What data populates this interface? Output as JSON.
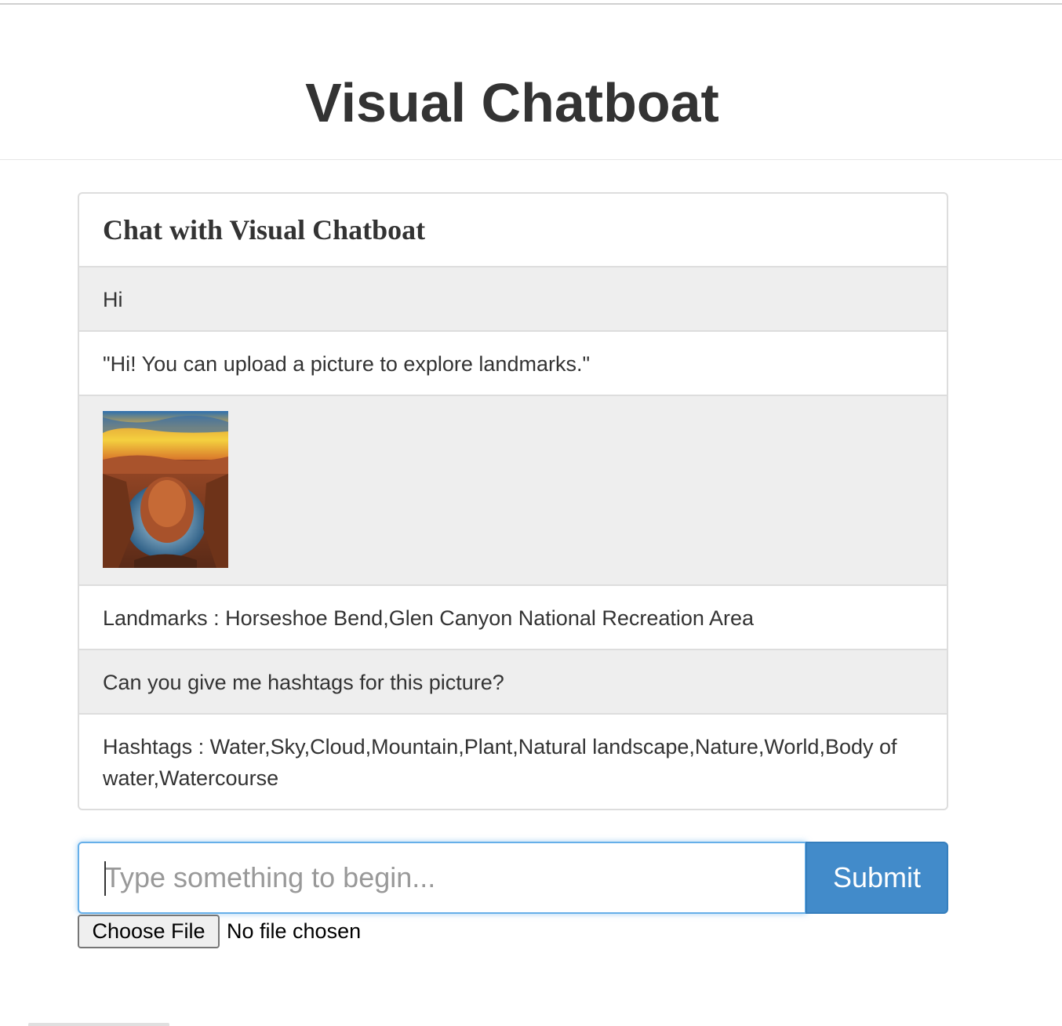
{
  "header": {
    "title": "Visual Chatboat"
  },
  "chat": {
    "panel_title": "Chat with Visual Chatboat",
    "messages": [
      {
        "from": "user",
        "text": "Hi"
      },
      {
        "from": "bot",
        "text": "\"Hi! You can upload a picture to explore landmarks.\""
      },
      {
        "from": "user",
        "type": "image"
      },
      {
        "from": "bot",
        "text": "Landmarks : Horseshoe Bend,Glen Canyon National Recreation Area"
      },
      {
        "from": "user",
        "text": "Can you give me hashtags for this picture?"
      },
      {
        "from": "bot",
        "text": "Hashtags : Water,Sky,Cloud,Mountain,Plant,Natural landscape,Nature,World,Body of water,Watercourse"
      }
    ]
  },
  "form": {
    "input_placeholder": "Type something to begin...",
    "input_value": "",
    "submit_label": "Submit",
    "file_button_label": "Choose File",
    "file_status": "No file chosen"
  },
  "colors": {
    "accent": "#428bca",
    "focus_border": "#66afe9",
    "user_row": "#eeeeee",
    "border": "#dddddd"
  }
}
